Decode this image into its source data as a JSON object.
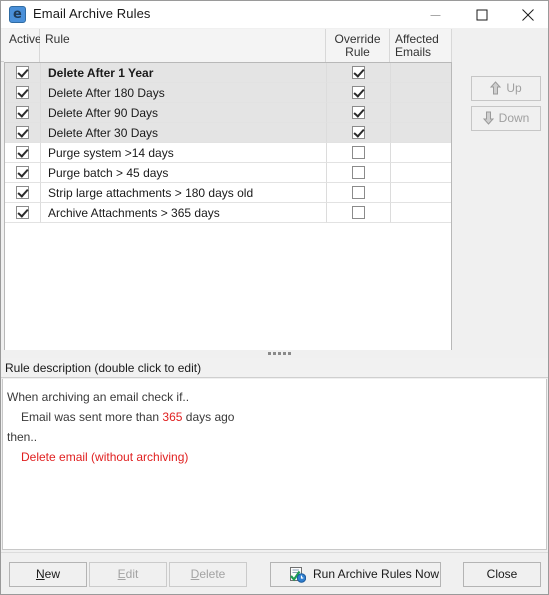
{
  "window": {
    "title": "Email Archive Rules",
    "icon": "email-archive-icon",
    "glyph": "e",
    "controls": {
      "minimize": "minimize-icon",
      "maximize": "maximize-icon",
      "close": "close-icon"
    }
  },
  "list": {
    "columns": [
      {
        "key": "active",
        "label": "Active"
      },
      {
        "key": "rule",
        "label": "Rule"
      },
      {
        "key": "override",
        "label": "Override\nRule",
        "line1": "Override",
        "line2": "Rule"
      },
      {
        "key": "affected",
        "label": "Affected\nEmails",
        "line1": "Affected",
        "line2": "Emails"
      }
    ],
    "rows": [
      {
        "active": true,
        "rule": "Delete After  1 Year",
        "override": true,
        "affected": "",
        "bold": true,
        "shaded": true,
        "focused": true
      },
      {
        "active": true,
        "rule": "Delete After  180 Days",
        "override": true,
        "affected": "",
        "bold": false,
        "shaded": true,
        "focused": false
      },
      {
        "active": true,
        "rule": "Delete After 90 Days",
        "override": true,
        "affected": "",
        "bold": false,
        "shaded": true,
        "focused": false
      },
      {
        "active": true,
        "rule": "Delete After 30 Days",
        "override": true,
        "affected": "",
        "bold": false,
        "shaded": true,
        "focused": false
      },
      {
        "active": true,
        "rule": "Purge system  >14 days",
        "override": false,
        "affected": "",
        "bold": false,
        "shaded": false,
        "focused": false
      },
      {
        "active": true,
        "rule": "Purge batch > 45 days",
        "override": false,
        "affected": "",
        "bold": false,
        "shaded": false,
        "focused": false
      },
      {
        "active": true,
        "rule": "Strip large attachments > 180 days old",
        "override": false,
        "affected": "",
        "bold": false,
        "shaded": false,
        "focused": false
      },
      {
        "active": true,
        "rule": "Archive Attachments  > 365 days",
        "override": false,
        "affected": "",
        "bold": false,
        "shaded": false,
        "focused": false
      }
    ]
  },
  "side_buttons": {
    "up": {
      "label": "Up",
      "icon": "arrow-up-icon",
      "enabled": false
    },
    "down": {
      "label": "Down",
      "icon": "arrow-down-icon",
      "enabled": false
    }
  },
  "description": {
    "header": "Rule description (double click to edit)",
    "lines": [
      {
        "text": "When archiving an email check if..",
        "indent": false,
        "red": false
      },
      {
        "prefix": "Email was sent more than ",
        "number": "365",
        "suffix": " days ago",
        "indent": true,
        "red": false
      },
      {
        "text": "then..",
        "indent": false,
        "red": false
      },
      {
        "text": "Delete email (without archiving)",
        "indent": true,
        "red": true
      }
    ]
  },
  "buttons": {
    "new": {
      "mnemonic": "N",
      "rest": "ew",
      "enabled": true
    },
    "edit": {
      "label": "Edit",
      "mnemonic": "E",
      "enabled": false
    },
    "delete": {
      "label": "Delete",
      "mnemonic": "D",
      "enabled": false
    },
    "run": {
      "label": "Run Archive Rules Now",
      "icon": "run-rules-icon",
      "enabled": true
    },
    "close": {
      "label": "Close",
      "enabled": true
    }
  },
  "colors": {
    "accent": "#4a90d9",
    "danger": "#e02020",
    "row_shaded": "#e4e4e4",
    "window_bg": "#f0f0f0"
  }
}
